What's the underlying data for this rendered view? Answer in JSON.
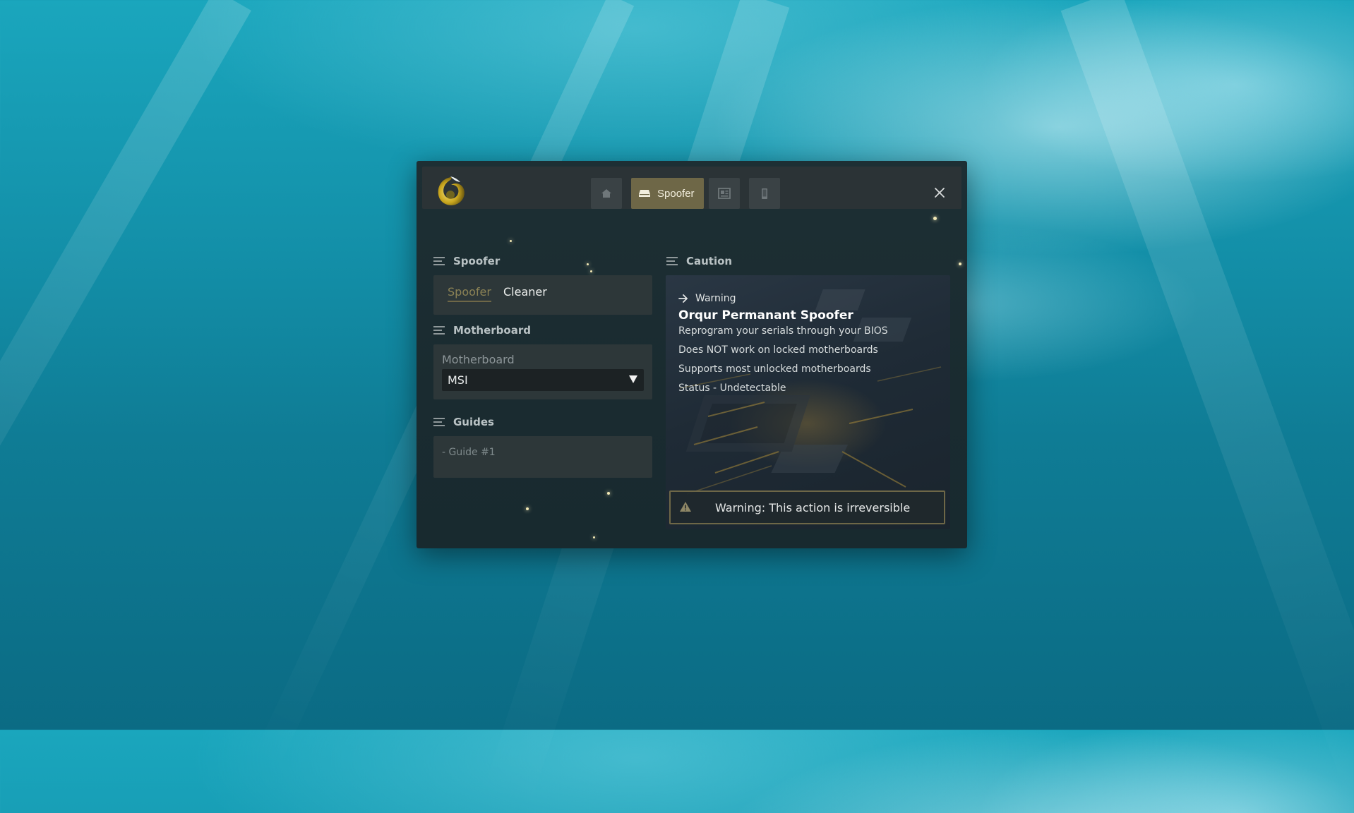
{
  "nav": {
    "items": [
      {
        "icon": "home-icon",
        "label": ""
      },
      {
        "icon": "drive-icon",
        "label": "Spoofer"
      },
      {
        "icon": "news-icon",
        "label": ""
      },
      {
        "icon": "phone-icon",
        "label": ""
      }
    ],
    "close_icon": "close-icon"
  },
  "spoofer_section": {
    "title": "Spoofer",
    "tabs": [
      "Spoofer",
      "Cleaner"
    ],
    "active_tab": "Spoofer"
  },
  "motherboard_section": {
    "title": "Motherboard",
    "field_label": "Motherboard",
    "selected": "MSI"
  },
  "guides_section": {
    "title": "Guides",
    "items": [
      "- Guide #1"
    ]
  },
  "caution_section": {
    "title": "Caution",
    "kicker": "Warning",
    "heading": "Orqur Permanant Spoofer",
    "lines": [
      "Reprogram your serials through your BIOS",
      "Does NOT work on locked motherboards",
      "Supports most unlocked motherboards",
      "Status - Undetectable"
    ],
    "banner": "Warning: This action is irreversible"
  },
  "colors": {
    "accent": "#6e6747",
    "window_bg": "#1a2b30",
    "panel_bg": "#2d3739"
  }
}
